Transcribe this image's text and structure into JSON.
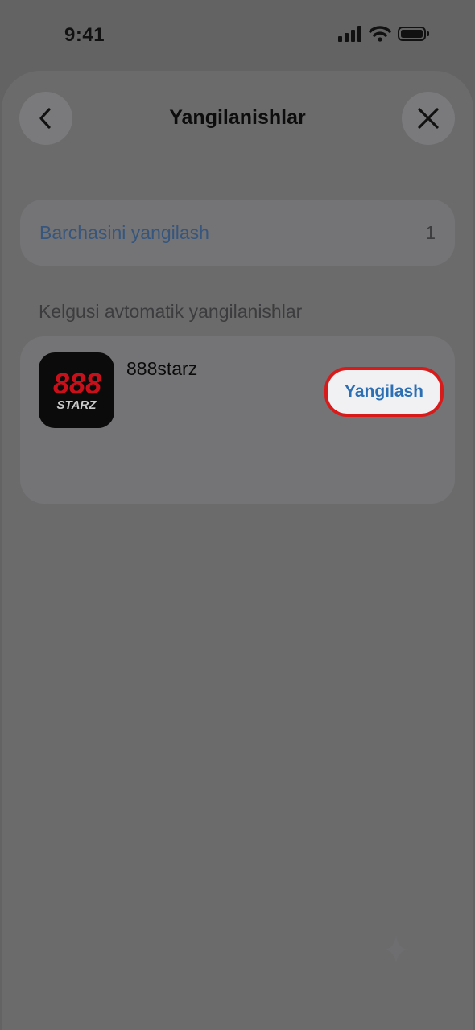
{
  "status_bar": {
    "time": "9:41"
  },
  "header": {
    "title": "Yangilanishlar"
  },
  "update_all": {
    "label": "Barchasini yangilash",
    "count": "1"
  },
  "section": {
    "title": "Kelgusi avtomatik yangilanishlar"
  },
  "apps": [
    {
      "name": "888starz",
      "icon_text_top": "888",
      "icon_text_bottom": "STARZ",
      "action_label": "Yangilash"
    }
  ],
  "colors": {
    "overlay_background": "#636364",
    "link_blue": "#2c6fb5",
    "highlight_red": "#d91a1a",
    "icon_red": "#c8101b"
  },
  "icons": {
    "back": "chevron-left-icon",
    "close": "close-icon",
    "signal": "cellular-signal-icon",
    "wifi": "wifi-icon",
    "battery": "battery-icon",
    "sparkle": "sparkle-icon"
  }
}
